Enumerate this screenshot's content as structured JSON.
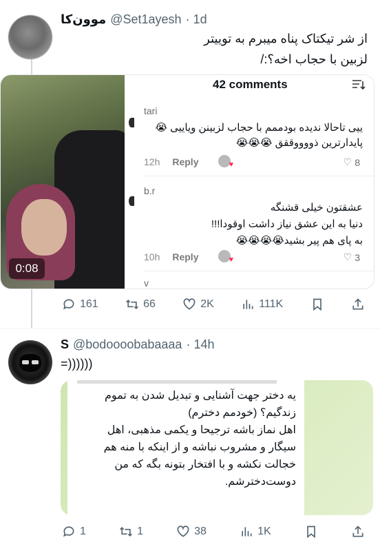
{
  "tweet1": {
    "name": "موون‌کا",
    "handle": "@Set1ayesh",
    "time": "· 1d",
    "text_line1": "از شر تیکتاک پناه میبرم به توییتر",
    "text_line2": "لزبین با حجاب اخه؟:/",
    "video_duration": "0:08",
    "comments_title": "42 comments",
    "comments": [
      {
        "user": "tari",
        "line1": "ییی تاحالا ندیده بودممم با حجاب لزبینن ویاییی 😭",
        "line2": "پایدارترین ذووووققق 😭😭😭",
        "time": "12h",
        "reply": "Reply",
        "likes": "8"
      },
      {
        "user": "b.r",
        "line1": "عشقتون خیلی قشنگه",
        "line2": "دنیا به این عشق نیاز داشت اوقودا!!!",
        "line3": "به پای هم پیر بشید😭😭😭😭",
        "time": "10h",
        "reply": "Reply",
        "likes": "3"
      }
    ],
    "next_user_initial": "v",
    "stats": {
      "replies": "161",
      "retweets": "66",
      "likes": "2K",
      "views": "111K"
    }
  },
  "tweet2": {
    "name": "S",
    "handle": "@bodoooobabaaaa",
    "time": "· 14h",
    "text": "=))))))",
    "image_text": [
      "یه دختر جهت آشنایی و تبدیل شدن به تموم",
      "زندگیم؟ (خودمم دخترم)",
      "اهل نماز باشه ترجیحا و یکمی مذهبی، اهل",
      "سیگار و مشروب نباشه و از اینکه با منه هم",
      "خجالت نکشه و با افتخار بتونه بگه که من",
      "دوست‌دخترشم."
    ],
    "stats": {
      "replies": "1",
      "retweets": "1",
      "likes": "38",
      "views": "1K"
    }
  },
  "colors": {
    "muted": "#536471",
    "divider": "#eff3f4",
    "accent_heart": "#fe2c55",
    "telegram_bg": "#d9ecbf"
  }
}
